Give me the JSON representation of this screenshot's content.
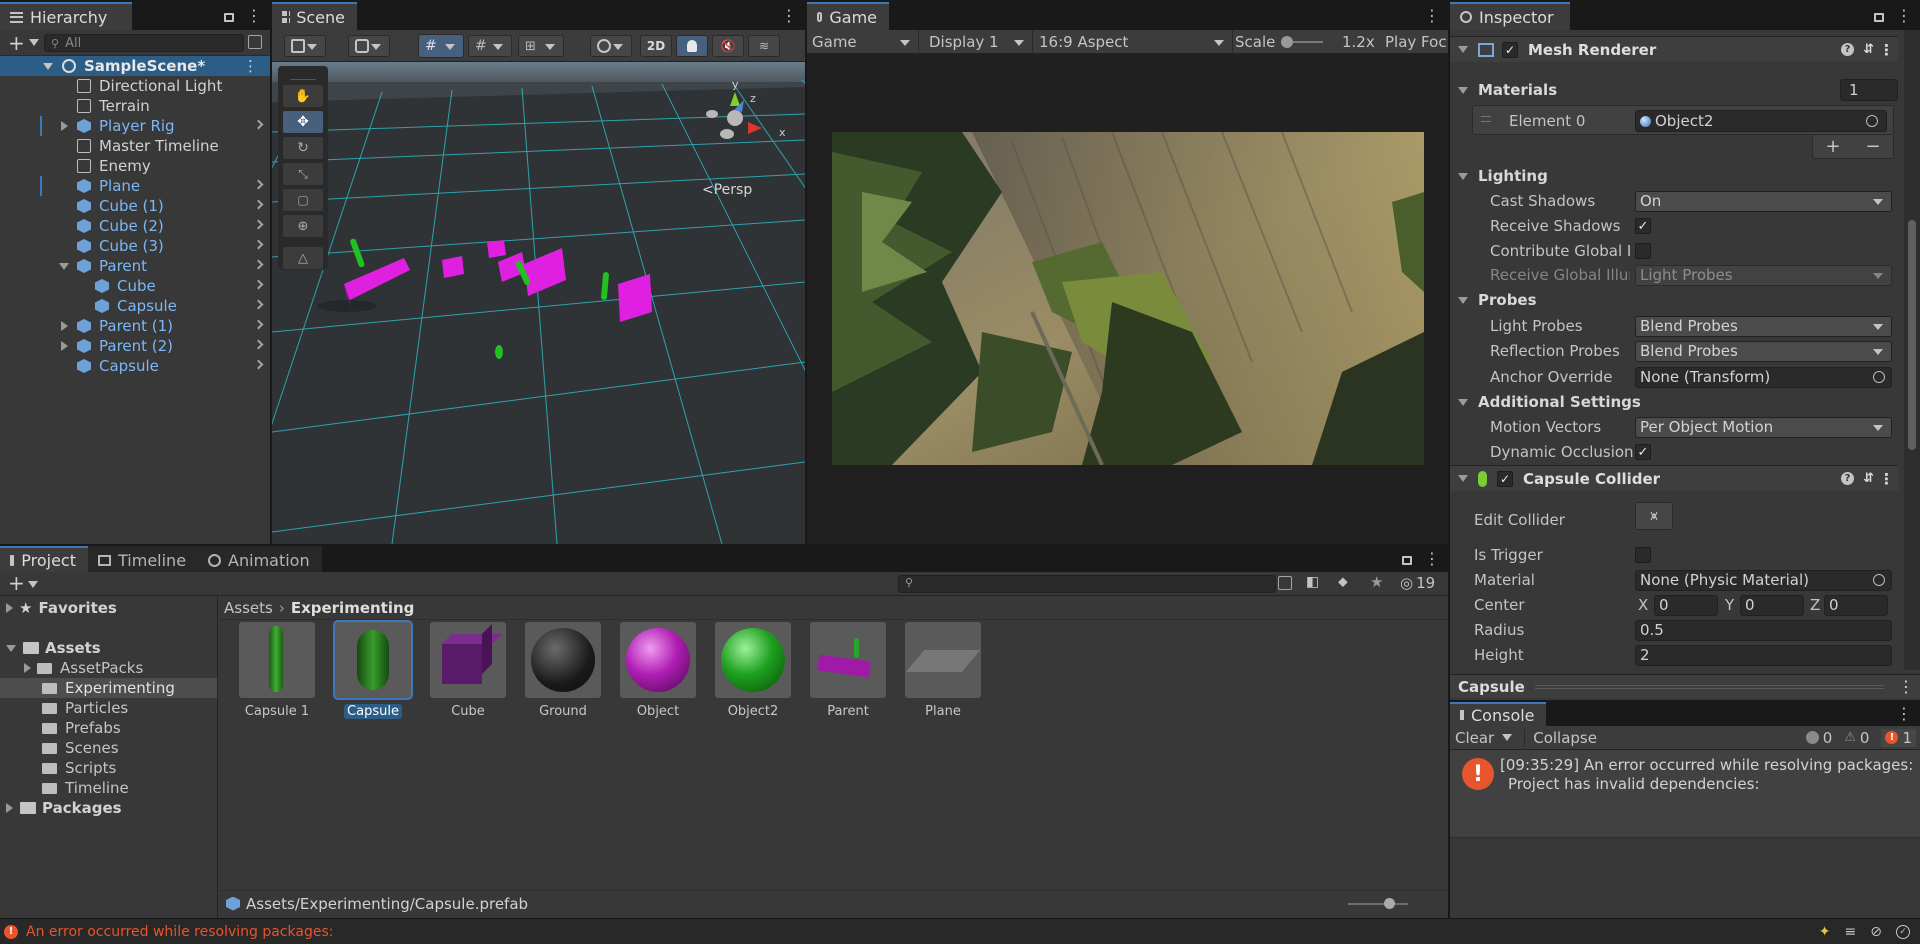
{
  "hierarchy": {
    "tab": "Hierarchy",
    "search_placeholder": "All",
    "scene": "SampleScene*",
    "items": [
      {
        "label": "Directional Light"
      },
      {
        "label": "Terrain"
      },
      {
        "label": "Player Rig"
      },
      {
        "label": "Master Timeline"
      },
      {
        "label": "Enemy"
      },
      {
        "label": "Plane"
      },
      {
        "label": "Cube (1)"
      },
      {
        "label": "Cube (2)"
      },
      {
        "label": "Cube (3)"
      },
      {
        "label": "Parent"
      },
      {
        "label": "Cube"
      },
      {
        "label": "Capsule"
      },
      {
        "label": "Parent (1)"
      },
      {
        "label": "Parent (2)"
      },
      {
        "label": "Capsule"
      }
    ]
  },
  "scene": {
    "tab": "Scene",
    "mode_2d": "2D",
    "persp": "<Persp",
    "gizmo_axes": {
      "y": "y",
      "z": "z",
      "x": "x"
    }
  },
  "game": {
    "tab": "Game",
    "mode": "Game",
    "display": "Display 1",
    "aspect": "16:9 Aspect",
    "scale_label": "Scale",
    "scale_value": "1.2x",
    "play_focused": "Play Foc"
  },
  "inspector": {
    "tab": "Inspector",
    "mesh_renderer": "Mesh Renderer",
    "materials": "Materials",
    "materials_count": "1",
    "element0_label": "Element 0",
    "element0_value": "Object2",
    "plus": "+",
    "minus": "−",
    "lighting": "Lighting",
    "cast_shadows_label": "Cast Shadows",
    "cast_shadows_value": "On",
    "receive_shadows_label": "Receive Shadows",
    "contribute_gi_label": "Contribute Global Ill",
    "receive_gi_label": "Receive Global Illun",
    "receive_gi_value": "Light Probes",
    "probes": "Probes",
    "light_probes_label": "Light Probes",
    "light_probes_value": "Blend Probes",
    "reflection_probes_label": "Reflection Probes",
    "reflection_probes_value": "Blend Probes",
    "anchor_override_label": "Anchor Override",
    "anchor_override_value": "None (Transform)",
    "additional_settings": "Additional Settings",
    "motion_vectors_label": "Motion Vectors",
    "motion_vectors_value": "Per Object Motion",
    "dynamic_occlusion_label": "Dynamic Occlusion",
    "capsule_collider": "Capsule Collider",
    "edit_collider_label": "Edit Collider",
    "is_trigger_label": "Is Trigger",
    "material_label": "Material",
    "material_value": "None (Physic Material)",
    "center_label": "Center",
    "center": {
      "x_label": "X",
      "x": "0",
      "y_label": "Y",
      "y": "0",
      "z_label": "Z",
      "z": "0"
    },
    "radius_label": "Radius",
    "radius_value": "0.5",
    "height_label": "Height",
    "height_value": "2",
    "preview_label": "Capsule"
  },
  "project": {
    "tabs": [
      "Project",
      "Timeline",
      "Animation"
    ],
    "hidden_count": "19",
    "tree": {
      "favorites": "Favorites",
      "assets": "Assets",
      "folders": [
        "AssetPacks",
        "Experimenting",
        "Particles",
        "Prefabs",
        "Scenes",
        "Scripts",
        "Timeline"
      ],
      "packages": "Packages"
    },
    "breadcrumb": [
      "Assets",
      "Experimenting"
    ],
    "assets": [
      {
        "label": "Capsule 1"
      },
      {
        "label": "Capsule"
      },
      {
        "label": "Cube"
      },
      {
        "label": "Ground"
      },
      {
        "label": "Object"
      },
      {
        "label": "Object2"
      },
      {
        "label": "Parent"
      },
      {
        "label": "Plane"
      }
    ],
    "selected_path": "Assets/Experimenting/Capsule.prefab"
  },
  "console": {
    "tab": "Console",
    "clear": "Clear",
    "collapse": "Collapse",
    "log_count": "0",
    "warn_count": "0",
    "error_count": "1",
    "message_line1": "[09:35:29] An error occurred while resolving packages:",
    "message_line2": "Project has invalid dependencies:"
  },
  "status_bar": {
    "message": "An error occurred while resolving packages:"
  },
  "colors": {
    "selection": "#2c5d87",
    "accent": "#3a79bb",
    "error": "#e8542b",
    "prefab_blue": "#7cb7f5"
  }
}
